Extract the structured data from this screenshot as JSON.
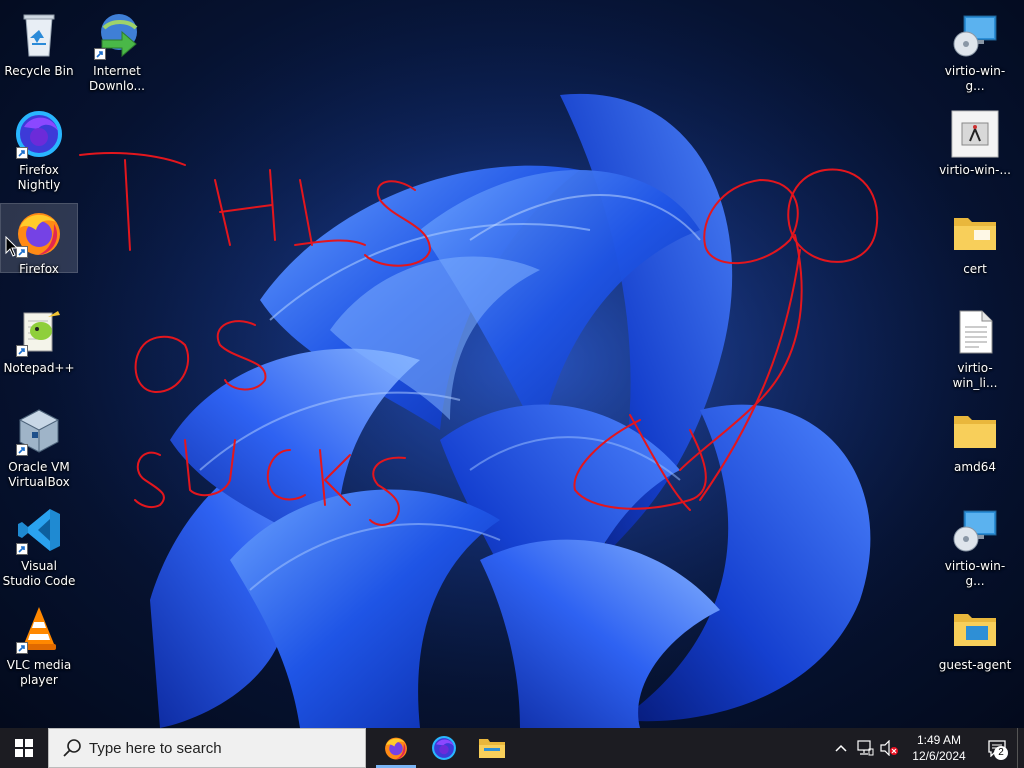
{
  "desktop": {
    "left_icons": [
      {
        "id": "recycle-bin",
        "label": "Recycle Bin",
        "icon": "recycle-bin-icon",
        "shortcut": false
      },
      {
        "id": "firefox-nightly",
        "label": "Firefox Nightly",
        "icon": "firefox-nightly-icon",
        "shortcut": true
      },
      {
        "id": "firefox",
        "label": "Firefox",
        "icon": "firefox-icon",
        "shortcut": true,
        "selected": true
      },
      {
        "id": "notepad-plus-plus",
        "label": "Notepad++",
        "icon": "notepad-plus-plus-icon",
        "shortcut": true
      },
      {
        "id": "oracle-vm-virtualbox",
        "label": "Oracle VM VirtualBox",
        "icon": "virtualbox-icon",
        "shortcut": true
      },
      {
        "id": "visual-studio-code",
        "label": "Visual Studio Code",
        "icon": "vscode-icon",
        "shortcut": true
      },
      {
        "id": "vlc-media-player",
        "label": "VLC media player",
        "icon": "vlc-icon",
        "shortcut": true
      }
    ],
    "second_column_icons": [
      {
        "id": "internet-download-manager",
        "label": "Internet Downlo...",
        "icon": "internet-download-manager-icon",
        "shortcut": true
      }
    ],
    "right_icons": [
      {
        "id": "virtio-win-gt-1",
        "label": "virtio-win-g...",
        "icon": "installer-disc-icon"
      },
      {
        "id": "virtio-win-app",
        "label": "virtio-win-...",
        "icon": "installer-app-icon"
      },
      {
        "id": "cert-folder",
        "label": "cert",
        "icon": "folder-icon"
      },
      {
        "id": "virtio-win-license",
        "label": "virtio-win_li...",
        "icon": "text-file-icon"
      },
      {
        "id": "amd64-folder",
        "label": "amd64",
        "icon": "folder-icon"
      },
      {
        "id": "virtio-win-gt-2",
        "label": "virtio-win-g...",
        "icon": "installer-disc-icon"
      },
      {
        "id": "guest-agent-folder",
        "label": "guest-agent",
        "icon": "folder-screen-icon"
      }
    ],
    "scribble_color": "#e3161d"
  },
  "taskbar": {
    "search_placeholder": "Type here to search",
    "pinned_apps": [
      {
        "id": "firefox",
        "icon": "firefox-icon",
        "active": true
      },
      {
        "id": "firefox-nightly",
        "icon": "firefox-nightly-icon",
        "active": false
      },
      {
        "id": "file-explorer",
        "icon": "file-explorer-icon",
        "active": false
      }
    ],
    "tray": {
      "time": "1:49 AM",
      "date": "12/6/2024",
      "notification_count": "2"
    }
  }
}
